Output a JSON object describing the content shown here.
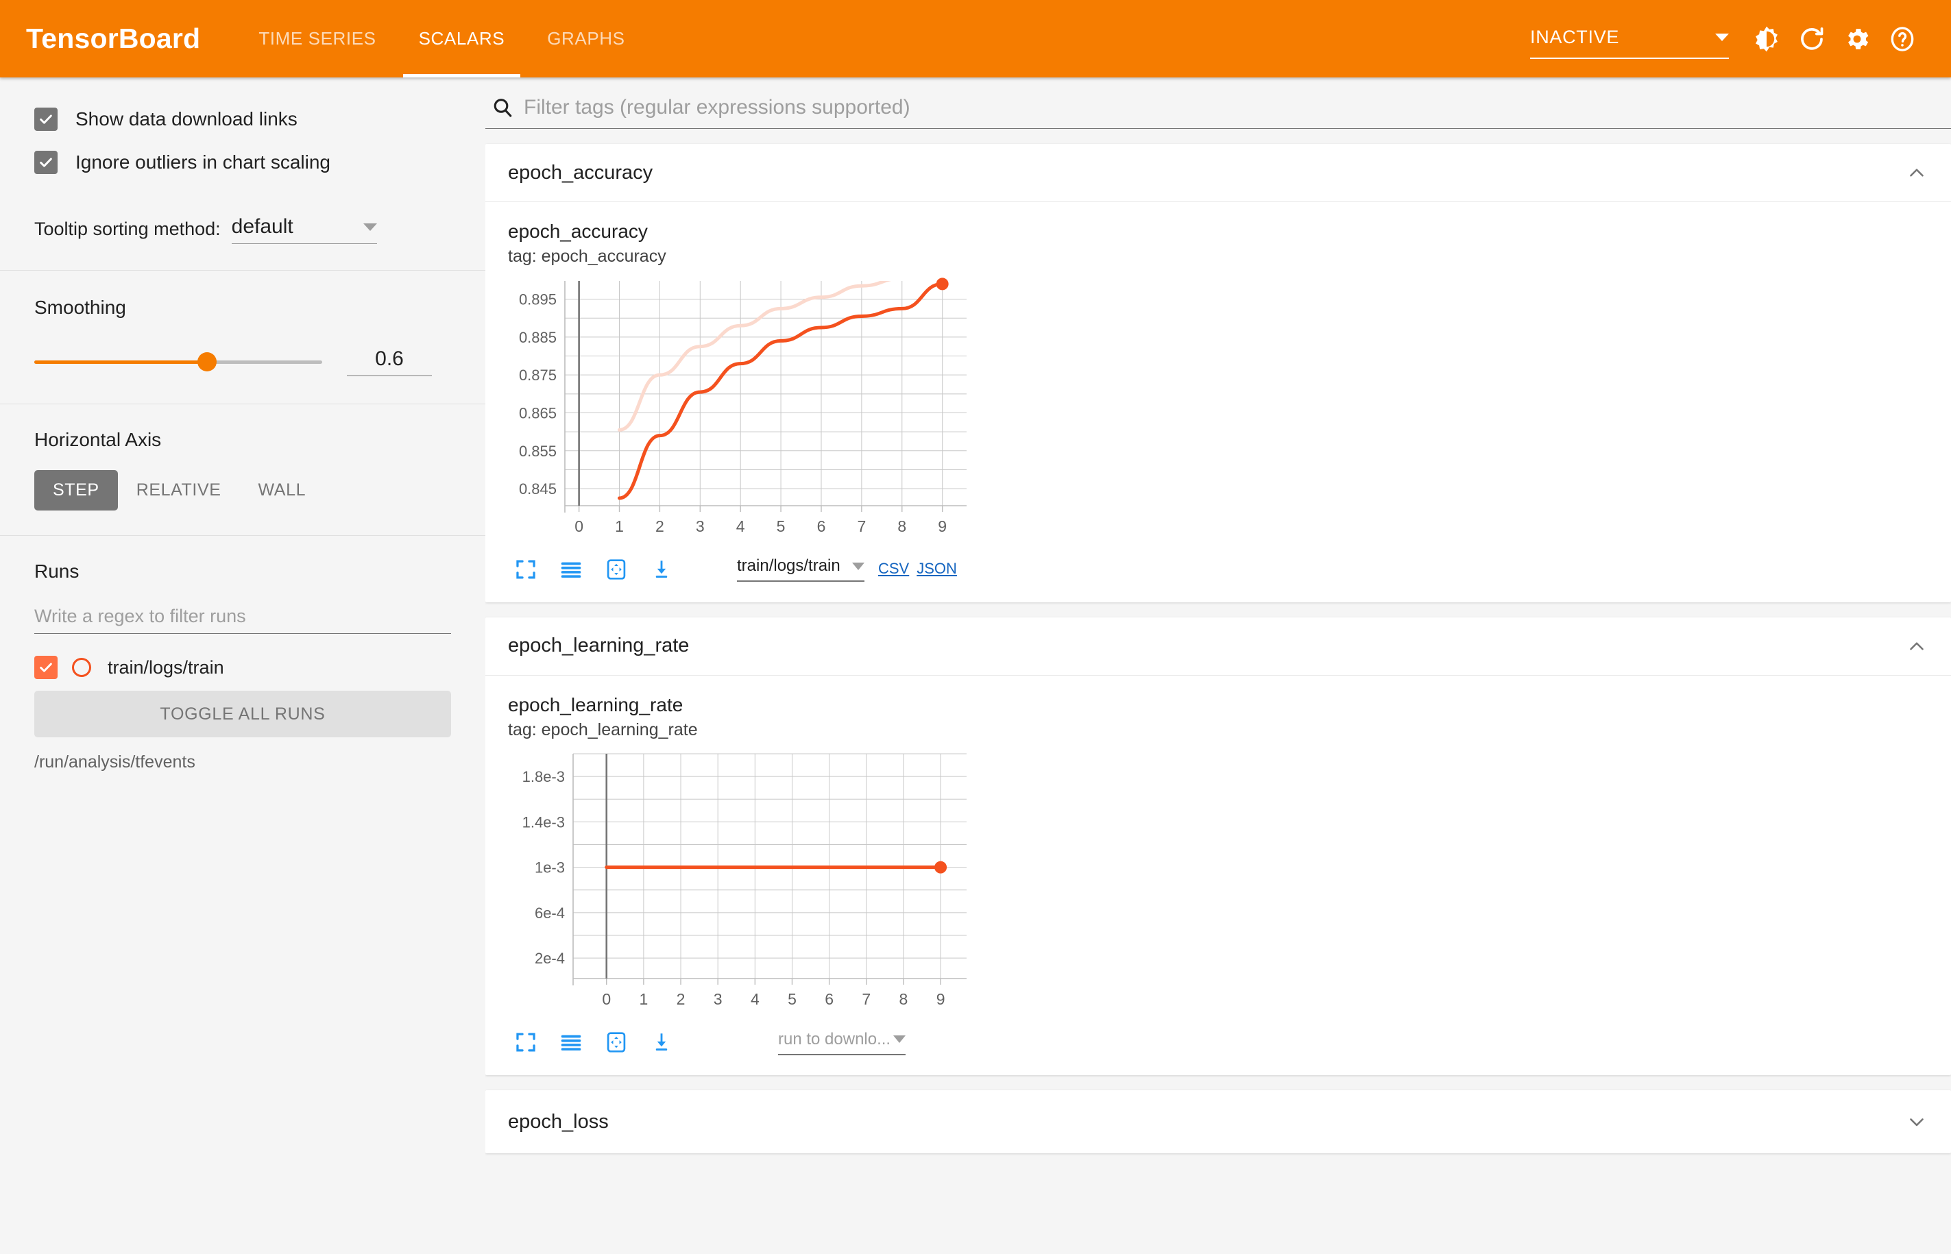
{
  "header": {
    "brand": "TensorBoard",
    "tabs": [
      {
        "label": "TIME SERIES",
        "active": false
      },
      {
        "label": "SCALARS",
        "active": true
      },
      {
        "label": "GRAPHS",
        "active": false
      }
    ],
    "status": "INACTIVE",
    "icons": [
      "brightness-icon",
      "refresh-icon",
      "gear-icon",
      "help-icon"
    ]
  },
  "sidebar": {
    "show_download_links": {
      "label": "Show data download links",
      "checked": true
    },
    "ignore_outliers": {
      "label": "Ignore outliers in chart scaling",
      "checked": true
    },
    "tooltip_sorting": {
      "label": "Tooltip sorting method:",
      "value": "default"
    },
    "smoothing": {
      "title": "Smoothing",
      "value": "0.6",
      "percent": 60
    },
    "horizontal_axis": {
      "title": "Horizontal Axis",
      "options": [
        {
          "label": "STEP",
          "active": true
        },
        {
          "label": "RELATIVE",
          "active": false
        },
        {
          "label": "WALL",
          "active": false
        }
      ]
    },
    "runs": {
      "title": "Runs",
      "filter_placeholder": "Write a regex to filter runs",
      "items": [
        {
          "name": "train/logs/train",
          "checked": true,
          "color": "#f4511e"
        }
      ],
      "toggle_all_label": "TOGGLE ALL RUNS",
      "logdir": "/run/analysis/tfevents"
    }
  },
  "main": {
    "filter_placeholder": "Filter tags (regular expressions supported)",
    "cards": [
      {
        "id": "epoch_accuracy",
        "title": "epoch_accuracy",
        "expanded": true,
        "chevron": "chevron-up-icon",
        "chart_name": "epoch_accuracy",
        "chart_tag": "tag: epoch_accuracy",
        "toolbar_icons": [
          "fullscreen-icon",
          "data-table-icon",
          "fit-domain-icon",
          "download-icon"
        ],
        "download": {
          "run_value": "train/logs/train",
          "is_placeholder": false,
          "links": [
            "CSV",
            "JSON"
          ]
        }
      },
      {
        "id": "epoch_learning_rate",
        "title": "epoch_learning_rate",
        "expanded": true,
        "chevron": "chevron-up-icon",
        "chart_name": "epoch_learning_rate",
        "chart_tag": "tag: epoch_learning_rate",
        "toolbar_icons": [
          "fullscreen-icon",
          "data-table-icon",
          "fit-domain-icon",
          "download-icon"
        ],
        "download": {
          "run_value": "run to downlo...",
          "is_placeholder": true,
          "links": []
        }
      },
      {
        "id": "epoch_loss",
        "title": "epoch_loss",
        "expanded": false,
        "chevron": "chevron-down-icon"
      }
    ]
  },
  "colors": {
    "brand_orange": "#f57c00",
    "series_orange": "#f4511e",
    "series_orange_faded": "#fbd9cd",
    "link_blue": "#1565c0",
    "toolbar_blue": "#2196f3"
  },
  "chart_data": [
    {
      "type": "line",
      "title": "epoch_accuracy",
      "subtitle": "tag: epoch_accuracy",
      "xlabel": "",
      "ylabel": "",
      "x": [
        0,
        1,
        2,
        3,
        4,
        5,
        6,
        7,
        8,
        9
      ],
      "xticks": [
        "0",
        "1",
        "2",
        "3",
        "4",
        "5",
        "6",
        "7",
        "8",
        "9"
      ],
      "yticks": [
        "0.845",
        "0.855",
        "0.865",
        "0.875",
        "0.885",
        "0.895"
      ],
      "ytickvals": [
        0.845,
        0.855,
        0.865,
        0.875,
        0.885,
        0.895
      ],
      "xlim": [
        -0.35,
        9.6
      ],
      "ylim": [
        0.8405,
        0.8998
      ],
      "grid": true,
      "series": [
        {
          "name": "train/logs/train (smoothed)",
          "color": "#f4511e",
          "opacity": 1,
          "values": [
            null,
            0.8425,
            0.859,
            0.8705,
            0.878,
            0.884,
            0.8875,
            0.8905,
            0.8925,
            0.899
          ],
          "end_marker": {
            "x": 9,
            "y": 0.899
          }
        },
        {
          "name": "train/logs/train (raw)",
          "color": "#fbd9cd",
          "opacity": 1,
          "values": [
            null,
            0.8605,
            0.875,
            0.8825,
            0.888,
            0.8925,
            0.8955,
            0.8985,
            0.9005,
            0.902
          ]
        }
      ]
    },
    {
      "type": "line",
      "title": "epoch_learning_rate",
      "subtitle": "tag: epoch_learning_rate",
      "xlabel": "",
      "ylabel": "",
      "x": [
        0,
        1,
        2,
        3,
        4,
        5,
        6,
        7,
        8,
        9
      ],
      "xticks": [
        "0",
        "1",
        "2",
        "3",
        "4",
        "5",
        "6",
        "7",
        "8",
        "9"
      ],
      "yticks": [
        "2e-4",
        "6e-4",
        "1e-3",
        "1.4e-3",
        "1.8e-3"
      ],
      "ytickvals": [
        0.0002,
        0.0006,
        0.001,
        0.0014,
        0.0018
      ],
      "xlim": [
        -0.9,
        9.7
      ],
      "ylim": [
        2e-05,
        0.002
      ],
      "grid": true,
      "series": [
        {
          "name": "train/logs/train",
          "color": "#f4511e",
          "opacity": 1,
          "values": [
            0.001,
            0.001,
            0.001,
            0.001,
            0.001,
            0.001,
            0.001,
            0.001,
            0.001,
            0.001
          ],
          "end_marker": {
            "x": 9,
            "y": 0.001
          }
        }
      ]
    }
  ]
}
